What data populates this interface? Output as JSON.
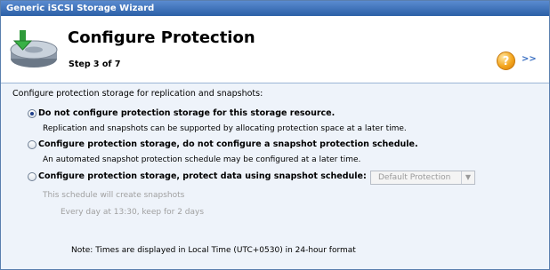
{
  "window": {
    "title": "Generic iSCSI Storage Wizard"
  },
  "header": {
    "title": "Configure Protection",
    "step": "Step 3 of 7",
    "more_label": ">>"
  },
  "content": {
    "intro": "Configure protection storage for replication and snapshots:",
    "options": [
      {
        "label": "Do not configure protection storage for this storage resource.",
        "description": "Replication and snapshots can be supported by allocating protection space at a later time.",
        "selected": true
      },
      {
        "label": "Configure protection storage, do not configure a snapshot protection schedule.",
        "description": "An automated snapshot protection schedule may be configured at a later time.",
        "selected": false
      },
      {
        "label": "Configure protection storage, protect data using snapshot schedule:",
        "selected": false
      }
    ],
    "schedule_select": {
      "value": "Default Protection"
    },
    "schedule_info": "This schedule will create snapshots",
    "schedule_detail": "Every day at 13:30, keep for 2 days",
    "note": "Note: Times are displayed in Local Time (UTC+0530) in 24-hour format"
  },
  "colors": {
    "titlebar": "#2b5fa6",
    "content_bg": "#eef3fa",
    "link": "#3a6fc2"
  }
}
